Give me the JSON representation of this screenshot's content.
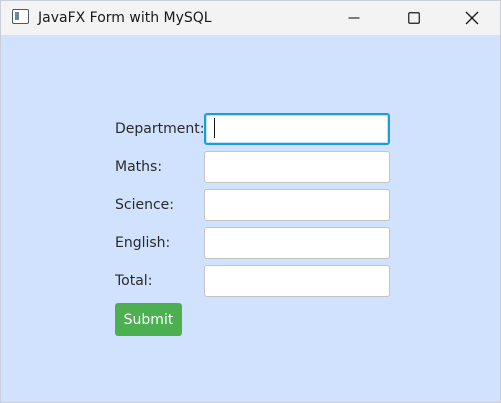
{
  "window": {
    "title": "JavaFX Form with MySQL",
    "background_color": "#d0e2fd"
  },
  "titlebar": {
    "icons": [
      "app-icon",
      "minimize-icon",
      "maximize-icon",
      "close-icon"
    ]
  },
  "form": {
    "fields": [
      {
        "label": "Department:",
        "value": "",
        "focused": true
      },
      {
        "label": "Maths:",
        "value": "",
        "focused": false
      },
      {
        "label": "Science:",
        "value": "",
        "focused": false
      },
      {
        "label": "English:",
        "value": "",
        "focused": false
      },
      {
        "label": "Total:",
        "value": "",
        "focused": false
      }
    ],
    "submit_label": "Submit",
    "submit_color": "#4caf50",
    "focus_color": "#1e9bdc"
  }
}
